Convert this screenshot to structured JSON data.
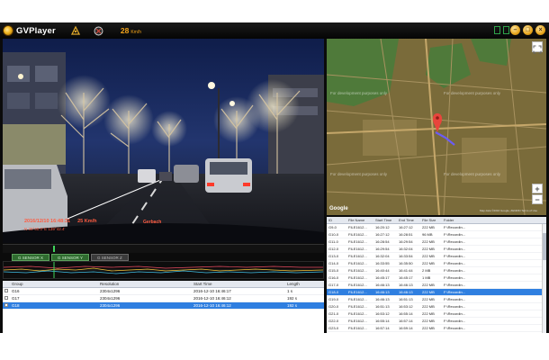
{
  "app": {
    "title": "GVPlayer"
  },
  "titlebar": {
    "speed_value": "28",
    "speed_unit": "Km/h"
  },
  "osd": {
    "date": "2016/12/10  16:48:31",
    "speed": "25 Km/h",
    "gps": "N 35°40.0'  E 139°42.4'",
    "brand": "Gerbach"
  },
  "graph": {
    "tabs": [
      "G SENSOR X",
      "G SENSOR Y",
      "G SENSOR Z"
    ]
  },
  "group_table": {
    "headers": {
      "group": "Group",
      "resolution": "Resolution",
      "start": "Start Time",
      "length": "Length"
    },
    "rows": [
      {
        "group": "G16",
        "resolution": "2304x1296",
        "start": "2016-12-10 16:46:17",
        "length": "1 s"
      },
      {
        "group": "G17",
        "resolution": "2304x1296",
        "start": "2016-12-10 16:46:12",
        "length": "192 s"
      },
      {
        "group": "G18",
        "resolution": "2304x1296",
        "start": "2016-12-10 16:46:12",
        "length": "192 s"
      }
    ],
    "selected_index": 2
  },
  "map": {
    "dev_note": "For development purposes only",
    "attribution": "Map data ©2016 Google, ZENRIN   Terms of Use",
    "google": "Google",
    "zoom_in": "+",
    "zoom_out": "−",
    "colors": {
      "route": "#6b5cf5",
      "pin": "#e8453c"
    }
  },
  "file_table": {
    "headers": {
      "id": "ID",
      "file": "File Name",
      "start": "Start Time",
      "end": "End Time",
      "size": "File Size",
      "folder": "Folder"
    },
    "rows": [
      {
        "id": "G9-0",
        "file": "FILE1612...",
        "start": "16:20:12",
        "end": "16:27:12",
        "size": "222 MB",
        "folder": "F:\\Recordin..."
      },
      {
        "id": "G10-0",
        "file": "FILE1612...",
        "start": "16:27:12",
        "end": "16:28:51",
        "size": "96 MB",
        "folder": "F:\\Recordin..."
      },
      {
        "id": "G11-0",
        "file": "FILE1612...",
        "start": "16:28:54",
        "end": "16:29:54",
        "size": "222 MB",
        "folder": "F:\\Recordin..."
      },
      {
        "id": "G12-0",
        "file": "FILE1612...",
        "start": "16:29:54",
        "end": "16:32:04",
        "size": "222 MB",
        "folder": "F:\\Recordin..."
      },
      {
        "id": "G13-0",
        "file": "FILE1612...",
        "start": "16:32:04",
        "end": "16:33:54",
        "size": "222 MB",
        "folder": "F:\\Recordin..."
      },
      {
        "id": "G14-0",
        "file": "FILE1612...",
        "start": "16:33:55",
        "end": "16:35:50",
        "size": "222 MB",
        "folder": "F:\\Recordin..."
      },
      {
        "id": "G15-0",
        "file": "FILE1612...",
        "start": "16:40:44",
        "end": "16:41:44",
        "size": "2 MB",
        "folder": "F:\\Recordin..."
      },
      {
        "id": "G16-0",
        "file": "FILE1612...",
        "start": "16:45:17",
        "end": "16:45:17",
        "size": "1 MB",
        "folder": "F:\\Recordin..."
      },
      {
        "id": "G17-0",
        "file": "FILE1612...",
        "start": "16:46:13",
        "end": "16:46:13",
        "size": "222 MB",
        "folder": "F:\\Recordin..."
      },
      {
        "id": "G18-0",
        "file": "FILE1612...",
        "start": "16:46:13",
        "end": "16:46:13",
        "size": "222 MB",
        "folder": "F:\\Recordin..."
      },
      {
        "id": "G19-0",
        "file": "FILE1612...",
        "start": "16:46:13",
        "end": "16:51:13",
        "size": "222 MB",
        "folder": "F:\\Recordin..."
      },
      {
        "id": "G20-0",
        "file": "FILE1612...",
        "start": "16:51:13",
        "end": "16:53:12",
        "size": "222 MB",
        "folder": "F:\\Recordin..."
      },
      {
        "id": "G21-0",
        "file": "FILE1612...",
        "start": "16:53:12",
        "end": "16:55:14",
        "size": "222 MB",
        "folder": "F:\\Recordin..."
      },
      {
        "id": "G22-0",
        "file": "FILE1612...",
        "start": "16:55:14",
        "end": "16:57:14",
        "size": "222 MB",
        "folder": "F:\\Recordin..."
      },
      {
        "id": "G23-0",
        "file": "FILE1612...",
        "start": "16:57:14",
        "end": "16:59:14",
        "size": "222 MB",
        "folder": "F:\\Recordin..."
      },
      {
        "id": "G24-0",
        "file": "FILE1612...",
        "start": "16:59:14",
        "end": "17:01:14",
        "size": "222 MB",
        "folder": "F:\\Recordin..."
      }
    ],
    "selected_index": 9
  },
  "toolbar": {
    "volume_fraction": 0.35,
    "icons": [
      "folder-open-icon",
      "snapshot-icon",
      "map-icon",
      "export-icon",
      "settings-icon"
    ],
    "playback": [
      "prev-icon",
      "stop-icon",
      "play-icon",
      "next-icon",
      "volume-icon"
    ]
  }
}
